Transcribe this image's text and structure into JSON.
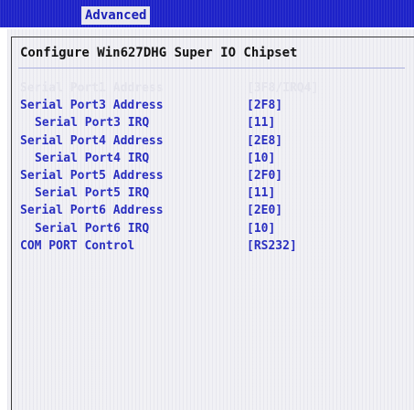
{
  "header": {
    "tab_label": "Advanced"
  },
  "page": {
    "title": "Configure Win627DHG Super IO Chipset"
  },
  "settings": [
    {
      "label": "Serial Port1 Address",
      "value": "[3F8/IRQ4]",
      "indent": false,
      "disabled": true
    },
    {
      "label": "Serial Port3 Address",
      "value": "[2F8]",
      "indent": false,
      "disabled": false
    },
    {
      "label": "Serial Port3 IRQ",
      "value": "[11]",
      "indent": true,
      "disabled": false
    },
    {
      "label": "Serial Port4 Address",
      "value": "[2E8]",
      "indent": false,
      "disabled": false
    },
    {
      "label": "Serial Port4 IRQ",
      "value": "[10]",
      "indent": true,
      "disabled": false
    },
    {
      "label": "Serial Port5 Address",
      "value": "[2F0]",
      "indent": false,
      "disabled": false
    },
    {
      "label": "Serial Port5 IRQ",
      "value": "[11]",
      "indent": true,
      "disabled": false
    },
    {
      "label": "Serial Port6 Address",
      "value": "[2E0]",
      "indent": false,
      "disabled": false
    },
    {
      "label": "Serial Port6 IRQ",
      "value": "[10]",
      "indent": true,
      "disabled": false
    },
    {
      "label": "COM PORT Control",
      "value": "[RS232]",
      "indent": false,
      "disabled": false
    }
  ],
  "colors": {
    "header_blue": "#1d22c8",
    "setting_text": "#2a2fc0",
    "title_text": "#141414"
  }
}
